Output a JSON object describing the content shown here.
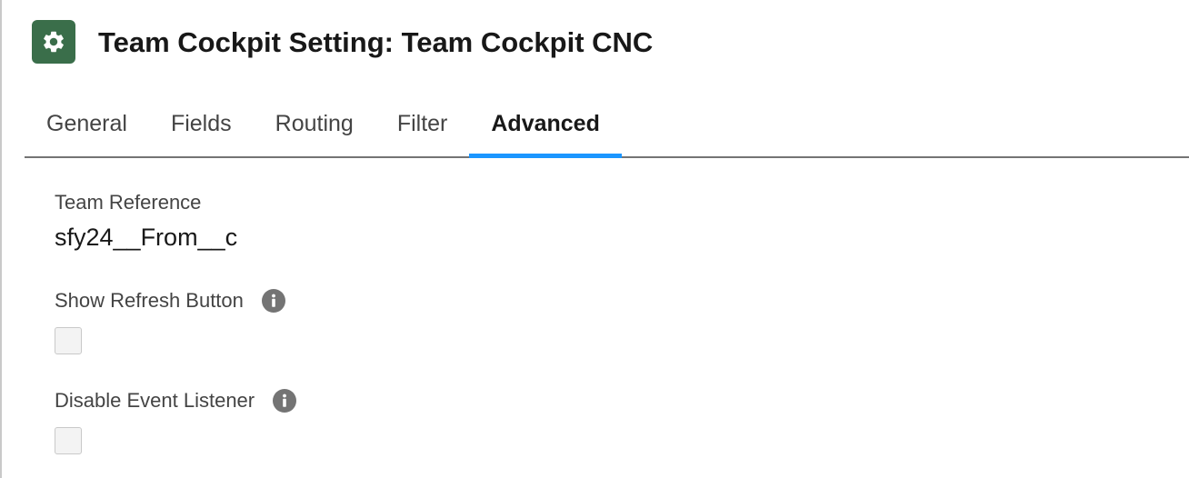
{
  "header": {
    "icon": "gear-icon",
    "icon_color": "#3a6e4a",
    "title": "Team Cockpit Setting: Team Cockpit CNC"
  },
  "tabs": [
    {
      "label": "General",
      "active": false
    },
    {
      "label": "Fields",
      "active": false
    },
    {
      "label": "Routing",
      "active": false
    },
    {
      "label": "Filter",
      "active": false
    },
    {
      "label": "Advanced",
      "active": true
    }
  ],
  "accent_color": "#1b96ff",
  "fields": {
    "team_reference": {
      "label": "Team Reference",
      "value": "sfy24__From__c"
    },
    "show_refresh_button": {
      "label": "Show Refresh Button",
      "info_icon": "info-icon",
      "checked": false
    },
    "disable_event_listener": {
      "label": "Disable Event Listener",
      "info_icon": "info-icon",
      "checked": false
    }
  }
}
